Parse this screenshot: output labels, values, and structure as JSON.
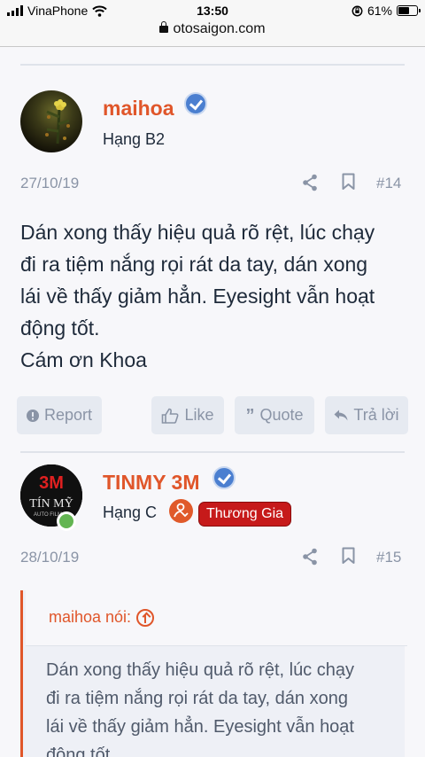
{
  "status_bar": {
    "carrier": "VinaPhone",
    "time": "13:50",
    "battery": "61%",
    "battery_level": 0.61
  },
  "browser": {
    "url": "otosaigon.com"
  },
  "posts": [
    {
      "username": "maihoa",
      "rank": "Hạng B2",
      "date": "27/10/19",
      "number": "#14",
      "body": [
        "Dán xong thấy hiệu quả rõ rệt, lúc chạy",
        "đi ra tiệm nắng rọi rát da tay, dán xong",
        "lái về thấy giảm hẳn. Eyesight vẫn hoạt",
        "động tốt.",
        "Cám ơn Khoa"
      ],
      "actions": {
        "report": "Report",
        "like": "Like",
        "quote": "Quote",
        "reply": "Trả lời"
      }
    },
    {
      "username": "TINMY 3M",
      "rank": "Hạng C",
      "badge": "Thương Gia",
      "date": "28/10/19",
      "number": "#15",
      "avatar_text": {
        "logo": "3M",
        "name": "TÍN MỸ",
        "sub": "AUTO FILM"
      },
      "quote": {
        "author": "maihoa nói:",
        "body": [
          "Dán xong thấy hiệu quả rõ rệt, lúc chạy",
          "đi ra tiệm nắng rọi rát da tay, dán xong",
          "lái về thấy giảm hẳn. Eyesight vẫn hoạt",
          "động tốt."
        ]
      }
    }
  ],
  "colors": {
    "accent": "#e0562a",
    "verified": "#4b7fd0",
    "muted": "#8a94a6",
    "button_bg": "#e6eaf1",
    "badge_red": "#c61a1a",
    "online": "#63b552"
  }
}
